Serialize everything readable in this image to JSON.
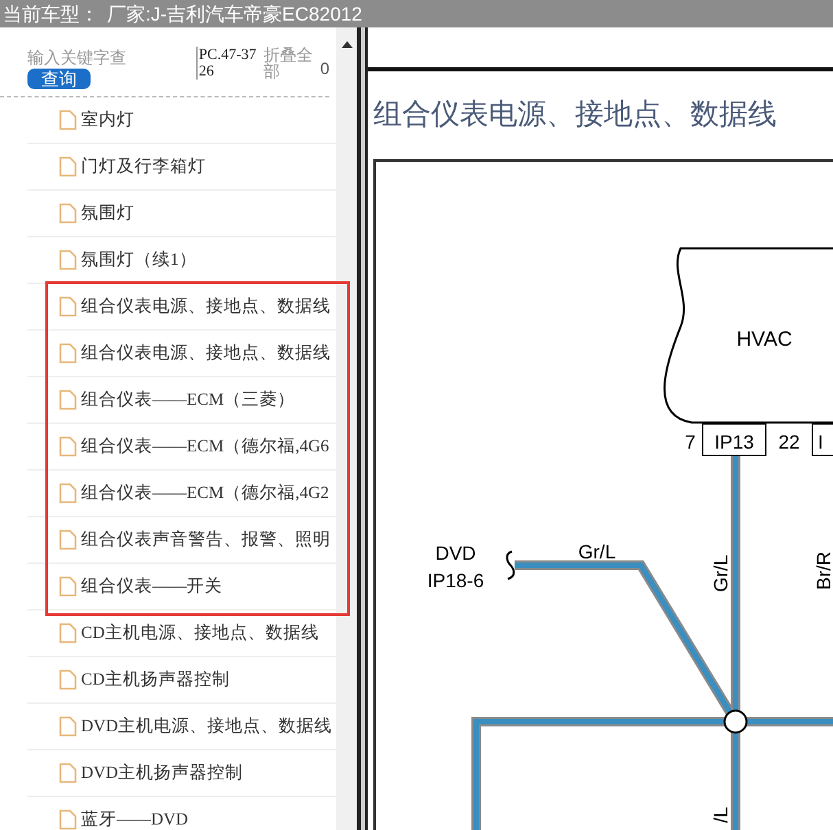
{
  "top_bar": {
    "label": "当前车型：",
    "model": "厂家:J-吉利汽车帝豪EC82012"
  },
  "sidebar": {
    "search": {
      "placeholder": "输入关键字查"
    },
    "search_button": "查询",
    "code": "PC.47-3726",
    "collapse_all": "折叠全部",
    "column_4": "0",
    "groups": [
      {
        "highlighted": false,
        "items": [
          "室内灯",
          "门灯及行李箱灯",
          "氛围灯",
          "氛围灯（续1）"
        ]
      },
      {
        "highlighted": true,
        "items": [
          "组合仪表电源、接地点、数据线",
          "组合仪表电源、接地点、数据线",
          "组合仪表——ECM（三菱）",
          "组合仪表——ECM（德尔福,4G6",
          "组合仪表——ECM（德尔福,4G2",
          "组合仪表声音警告、报警、照明",
          "组合仪表——开关"
        ]
      },
      {
        "highlighted": false,
        "items": [
          "CD主机电源、接地点、数据线",
          "CD主机扬声器控制",
          "DVD主机电源、接地点、数据线",
          "DVD主机扬声器控制",
          "蓝牙——DVD"
        ]
      }
    ]
  },
  "document": {
    "title": "组合仪表电源、接地点、数据线",
    "diagram": {
      "module": "HVAC",
      "pins": [
        "7",
        "IP13",
        "22",
        "I"
      ],
      "connector_name": "DVD",
      "connector_pin": "IP18-6",
      "wire_labels": [
        "Gr/L",
        "Gr/L",
        "Br/R",
        "/L"
      ]
    }
  }
}
